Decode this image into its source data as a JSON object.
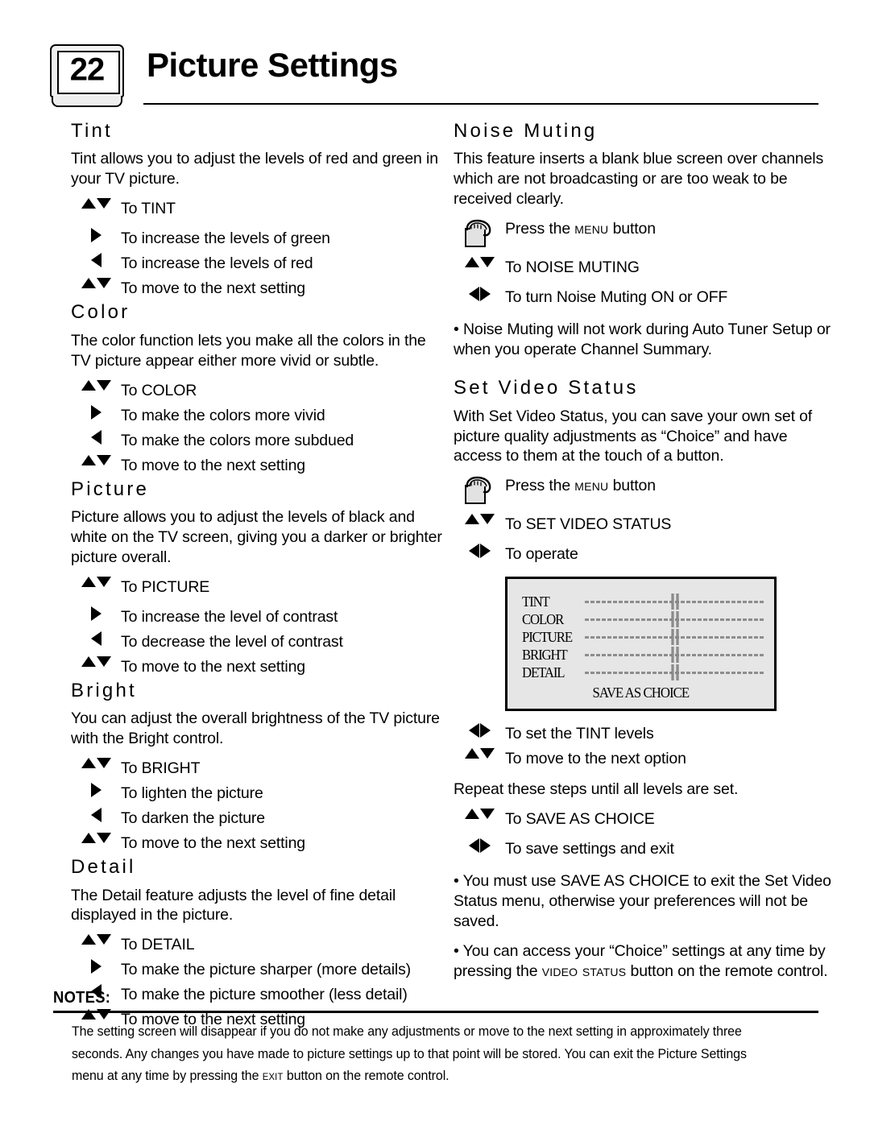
{
  "header": {
    "page_number": "22",
    "title": "Picture Settings"
  },
  "left_column": {
    "sections": [
      {
        "title": "Tint",
        "body": "Tint allows you to adjust the levels of red and green in your TV picture.",
        "steps": [
          {
            "icon": "up-down-arrows-icon",
            "label": "To TINT"
          },
          {
            "icon": "right-arrow-icon",
            "label": "To increase the levels of green"
          },
          {
            "icon": "left-arrow-icon",
            "label": "To increase the levels of red"
          },
          {
            "icon": "up-down-arrows-icon",
            "label": "To move to the next setting"
          }
        ]
      },
      {
        "title": "Color",
        "body": "The color function lets you make all the colors in the TV picture appear either more vivid or subtle.",
        "steps": [
          {
            "icon": "up-down-arrows-icon",
            "label": "To COLOR"
          },
          {
            "icon": "right-arrow-icon",
            "label": "To make the colors more vivid"
          },
          {
            "icon": "left-arrow-icon",
            "label": "To make the colors more subdued"
          },
          {
            "icon": "up-down-arrows-icon",
            "label": "To move to the next setting"
          }
        ]
      },
      {
        "title": "Picture",
        "body": "Picture allows you to adjust the levels of black and white on the TV screen, giving you a darker or brighter picture overall.",
        "steps": [
          {
            "icon": "up-down-arrows-icon",
            "label": "To PICTURE"
          },
          {
            "icon": "right-arrow-icon",
            "label": "To increase the level of contrast"
          },
          {
            "icon": "left-arrow-icon",
            "label": "To decrease the level of contrast"
          },
          {
            "icon": "up-down-arrows-icon",
            "label": "To move to the next setting"
          }
        ]
      },
      {
        "title": "Bright",
        "body": "You can adjust the overall brightness of the TV picture with the Bright control.",
        "steps": [
          {
            "icon": "up-down-arrows-icon",
            "label": "To BRIGHT"
          },
          {
            "icon": "right-arrow-icon",
            "label": "To lighten the picture"
          },
          {
            "icon": "left-arrow-icon",
            "label": "To darken the picture"
          },
          {
            "icon": "up-down-arrows-icon",
            "label": "To move to the next setting"
          }
        ]
      },
      {
        "title": "Detail",
        "body": "The Detail feature adjusts the level of fine detail displayed in the picture.",
        "steps": [
          {
            "icon": "up-down-arrows-icon",
            "label": "To DETAIL"
          },
          {
            "icon": "right-arrow-icon",
            "label": "To make the picture sharper (more details)"
          },
          {
            "icon": "left-arrow-icon",
            "label": "To make the picture smoother (less detail)"
          },
          {
            "icon": "up-down-arrows-icon",
            "label": "To move to the next setting"
          }
        ]
      }
    ]
  },
  "right_column": {
    "noise_muting": {
      "title": "Noise Muting",
      "body": "This feature inserts a blank blue screen over channels which are not broadcasting or are too weak to be received clearly.",
      "steps": [
        {
          "icon": "hand-press-button-icon",
          "label_prefix": "Press the ",
          "label_smallcaps": "Menu",
          "label_suffix": " button"
        },
        {
          "icon": "up-down-arrows-icon",
          "label": "To NOISE MUTING"
        },
        {
          "icon": "left-right-arrows-icon",
          "label": "To turn Noise Muting ON or OFF"
        }
      ],
      "note": "• Noise Muting will not work during Auto Tuner Setup or when you operate Channel Summary."
    },
    "set_video_status": {
      "title": "Set Video Status",
      "body": "With Set Video Status, you can save your own set of picture quality adjustments as “Choice” and have access to them at the touch of a button.",
      "steps": [
        {
          "icon": "hand-press-button-icon",
          "label_prefix": "Press the ",
          "label_smallcaps": "Menu",
          "label_suffix": " button"
        },
        {
          "icon": "up-down-arrows-icon",
          "label": "To SET VIDEO STATUS"
        },
        {
          "icon": "left-right-arrows-icon",
          "label": "To operate"
        }
      ],
      "osd": {
        "rows": [
          {
            "label": "TINT",
            "value_percent": 50
          },
          {
            "label": "COLOR",
            "value_percent": 50
          },
          {
            "label": "PICTURE",
            "value_percent": 50
          },
          {
            "label": "BRIGHT",
            "value_percent": 50
          },
          {
            "label": "DETAIL",
            "value_percent": 50
          }
        ],
        "save_label": "SAVE AS CHOICE"
      },
      "steps_after": [
        {
          "icon": "left-right-arrows-icon",
          "label": "To set the TINT levels"
        },
        {
          "icon": "up-down-arrows-icon",
          "label": "To move to the next option"
        }
      ],
      "repeat_text": "Repeat these steps until all levels are set.",
      "steps_final": [
        {
          "icon": "up-down-arrows-icon",
          "label": "To SAVE AS CHOICE"
        },
        {
          "icon": "left-right-arrows-icon",
          "label": "To save settings and exit"
        }
      ],
      "note_1": "•  You must use SAVE AS CHOICE to exit the Set Video Status menu, otherwise your preferences will not be saved.",
      "note_2_prefix": "•  You can access your “Choice” settings at any time by pressing the ",
      "note_2_smallcaps": "Video Status",
      "note_2_suffix": " button on the remote control."
    }
  },
  "notes": {
    "title": "NOTES:",
    "body_prefix": "The setting screen will disappear if you do not make any adjustments or move to the next setting in approximately three seconds. Any changes you have made to picture settings up to that point will be stored. You can exit the Picture Settings menu at any time by pressing the ",
    "body_smallcaps": "Exit",
    "body_suffix": " button on the remote control."
  }
}
